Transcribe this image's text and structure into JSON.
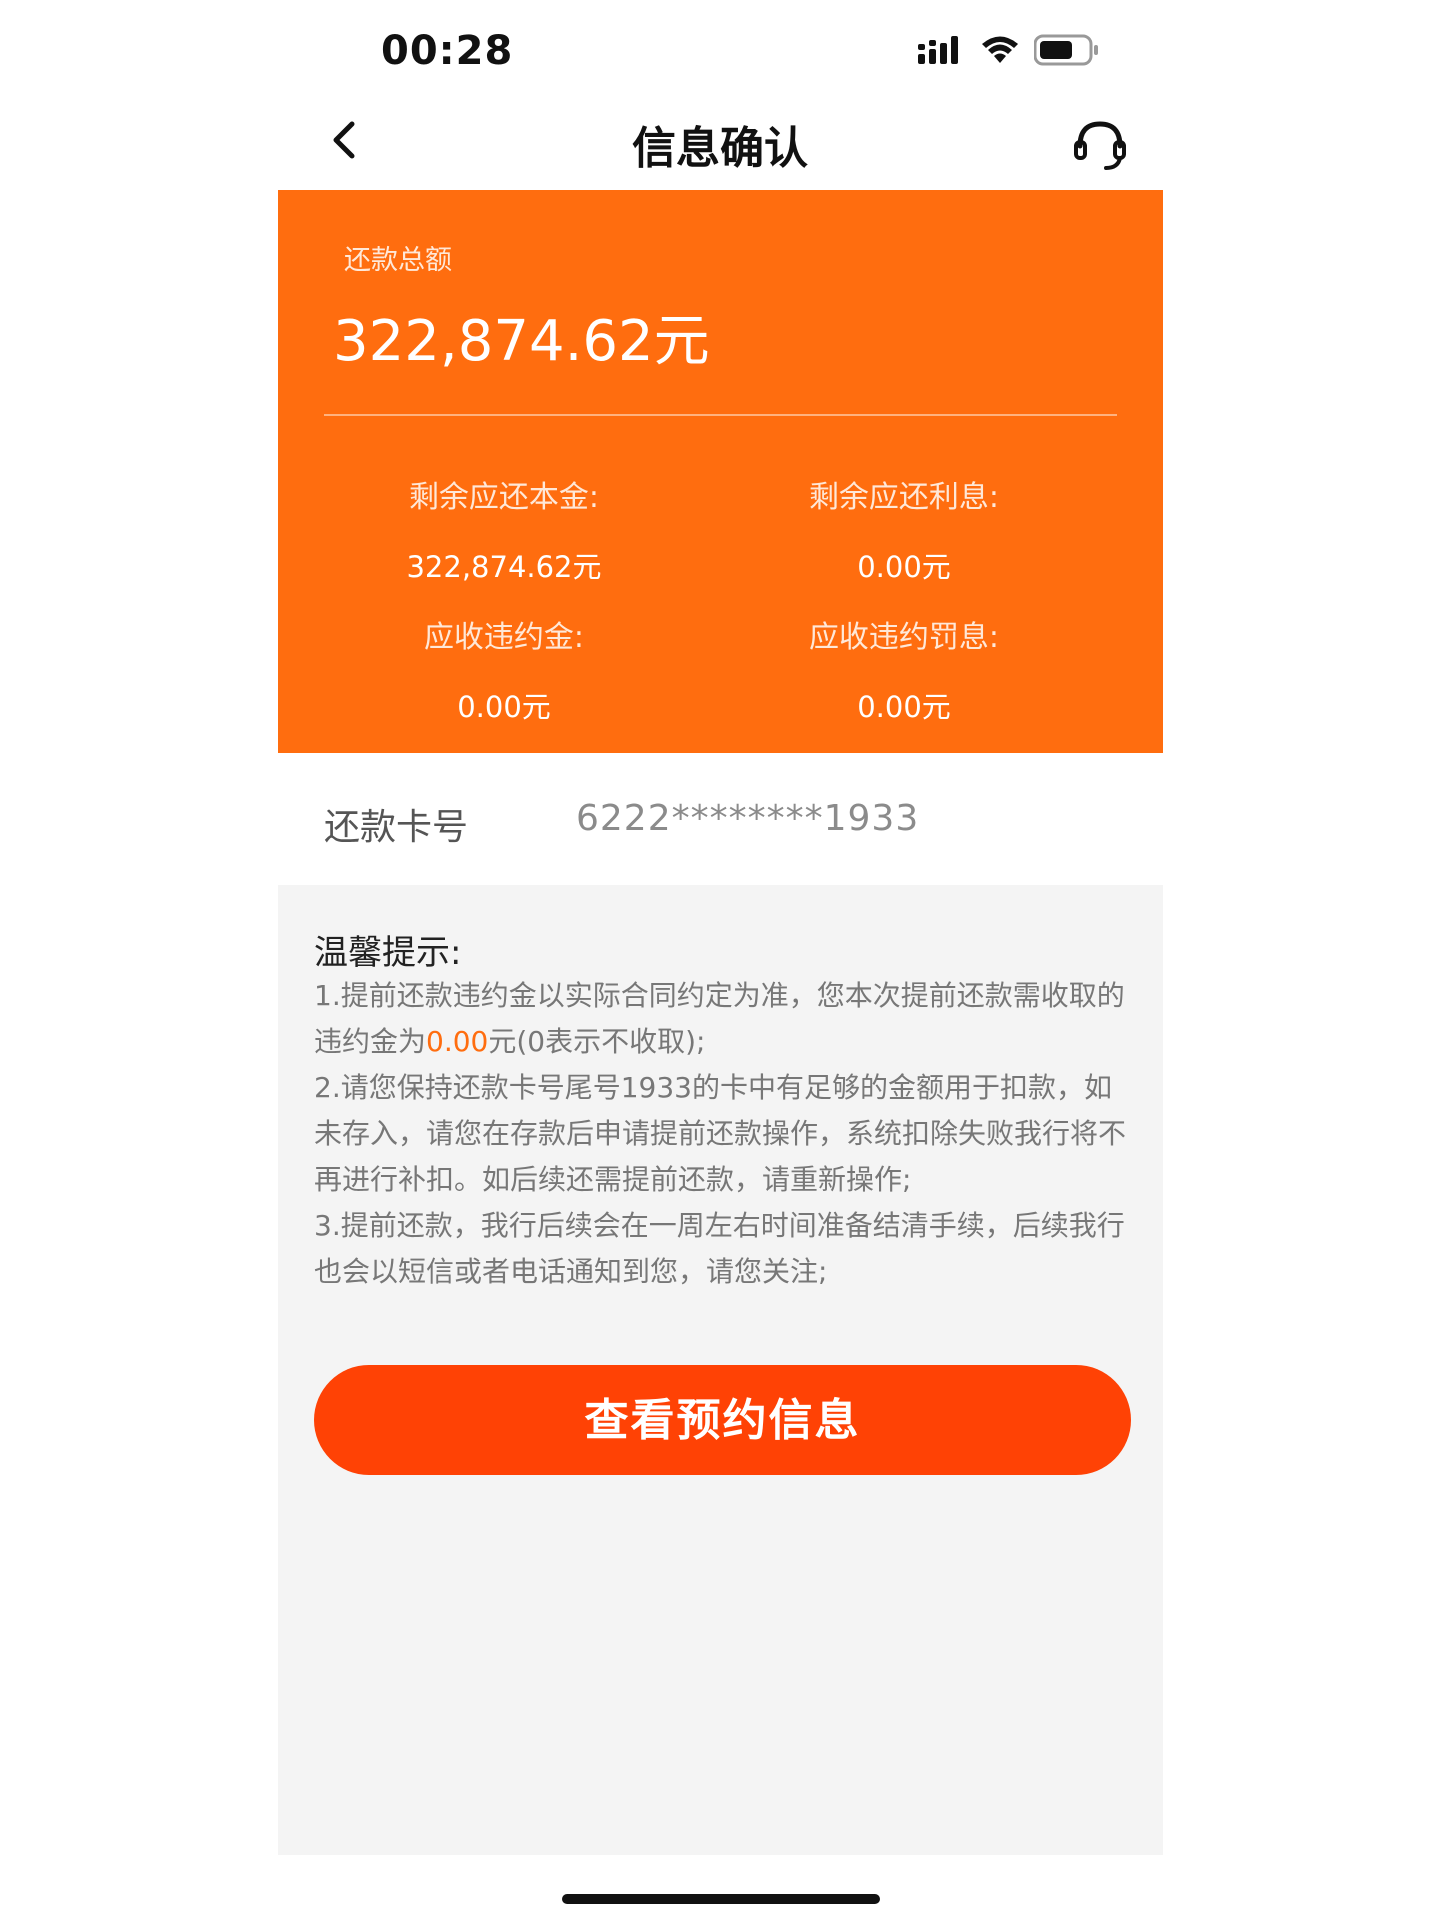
{
  "status_bar": {
    "time": "00:28"
  },
  "nav": {
    "title": "信息确认",
    "back_icon": "chevron-left-icon",
    "support_icon": "headset-icon"
  },
  "summary": {
    "total_label": "还款总额",
    "total_value": "322,874.62元",
    "items": [
      {
        "label": "剩余应还本金:",
        "value": "322,874.62元"
      },
      {
        "label": "剩余应还利息:",
        "value": "0.00元"
      },
      {
        "label": "应收违约金:",
        "value": "0.00元"
      },
      {
        "label": "应收违约罚息:",
        "value": "0.00元"
      }
    ]
  },
  "card": {
    "label": "还款卡号",
    "number": "6222********1933"
  },
  "tips": {
    "title": "温馨提示:",
    "item1_part1": "1.提前还款违约金以实际合同约定为准，您本次提前还款需收取的违约金为",
    "item1_amount": "0.00",
    "item1_part2": "元(0表示不收取);",
    "item2": "2.请您保持还款卡号尾号1933的卡中有足够的金额用于扣款，如未存入，请您在存款后申请提前还款操作，系统扣除失败我行将不再进行补扣。如后续还需提前还款，请重新操作;",
    "item3": "3.提前还款，我行后续会在一周左右时间准备结清手续，后续我行也会以短信或者电话通知到您，请您关注;"
  },
  "actions": {
    "primary_label": "查看预约信息"
  },
  "colors": {
    "panel": "#ff6d0f",
    "button": "#ff4205",
    "highlight": "#ff6d0f",
    "gray_bg": "#f4f4f4"
  }
}
